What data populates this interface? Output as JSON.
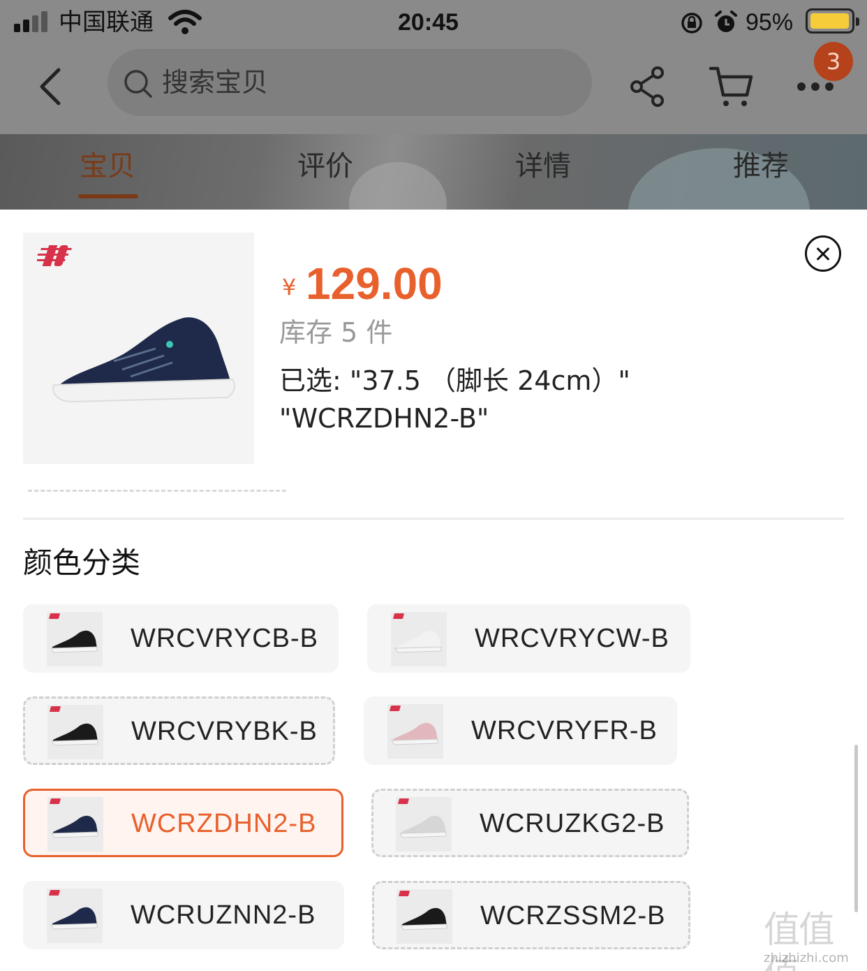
{
  "status_bar": {
    "carrier": "中国联通",
    "time": "20:45",
    "battery_percent": "95%",
    "battery_level": 0.95
  },
  "nav_bar": {
    "search_placeholder": "搜索宝贝",
    "cart_badge": "3"
  },
  "tabs": [
    {
      "label": "宝贝",
      "active": true
    },
    {
      "label": "评价",
      "active": false
    },
    {
      "label": "详情",
      "active": false
    },
    {
      "label": "推荐",
      "active": false
    }
  ],
  "product": {
    "currency_symbol": "¥",
    "price": "129.00",
    "stock": "库存 5 件",
    "selected_line1": "已选: \"37.5 （脚长 24cm）\"",
    "selected_line2": "\"WCRZDHN2-B\"",
    "shoe_color": "#1f2a4a"
  },
  "color_section": {
    "title": "颜色分类",
    "options": [
      {
        "label": "WRCVRYCB-B",
        "state": "normal",
        "shoe_color": "#1a1a1a"
      },
      {
        "label": "WRCVRYCW-B",
        "state": "normal",
        "shoe_color": "#f2f2f2"
      },
      {
        "label": "WRCVRYBK-B",
        "state": "dashed",
        "shoe_color": "#1a1a1a"
      },
      {
        "label": "WRCVRYFR-B",
        "state": "normal",
        "shoe_color": "#e2b8be"
      },
      {
        "label": "WCRZDHN2-B",
        "state": "selected",
        "shoe_color": "#1f2a4a"
      },
      {
        "label": "WCRUZKG2-B",
        "state": "dashed",
        "shoe_color": "#d6d6d6"
      },
      {
        "label": "WCRUZNN2-B",
        "state": "normal",
        "shoe_color": "#1f2a4a"
      },
      {
        "label": "WCRZSSM2-B",
        "state": "dashed",
        "shoe_color": "#1a1a1a"
      }
    ]
  },
  "colors": {
    "accent": "#e8602c",
    "badge": "#b5421a",
    "battery": "#f6cc3a"
  },
  "watermark": {
    "text": "值值值",
    "url": "zhizhizhi.com"
  }
}
